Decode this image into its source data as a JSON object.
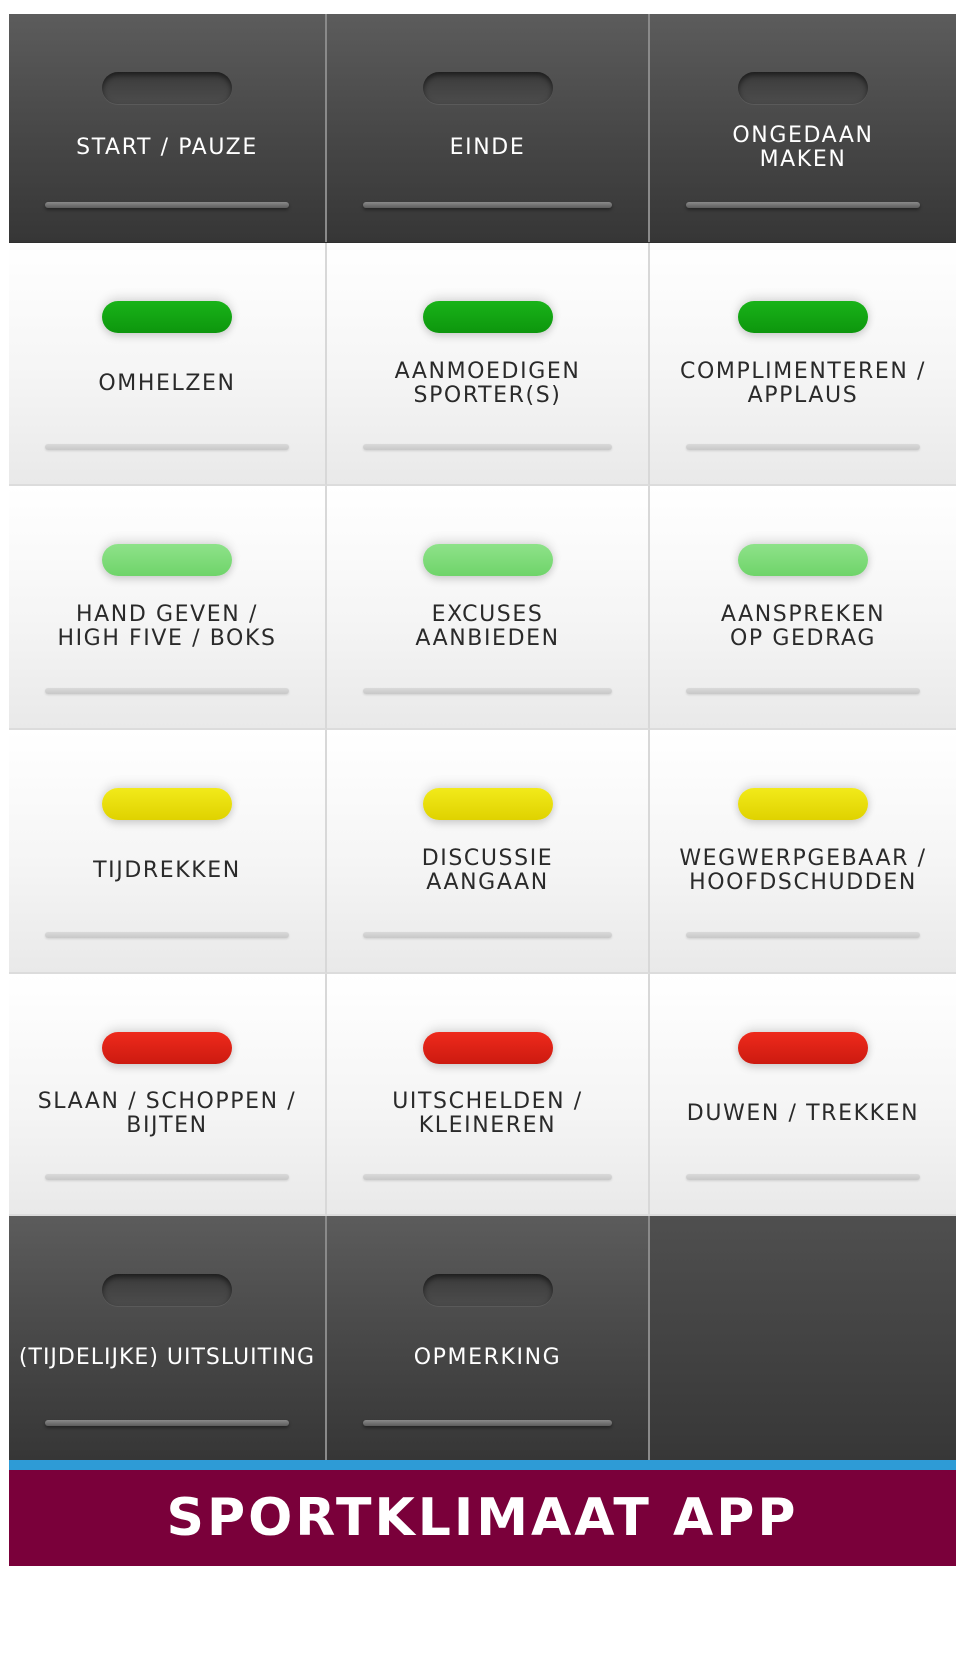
{
  "rows": [
    {
      "style": "dark",
      "cells": [
        {
          "label": "START / PAUZE",
          "indicator": "none"
        },
        {
          "label": "EINDE",
          "indicator": "none"
        },
        {
          "label": "ONGEDAAN\nMAKEN",
          "indicator": "none"
        }
      ]
    },
    {
      "style": "light",
      "cells": [
        {
          "label": "OMHELZEN",
          "indicator": "green"
        },
        {
          "label": "AANMOEDIGEN\nSPORTER(S)",
          "indicator": "green"
        },
        {
          "label": "COMPLIMENTEREN /\nAPPLAUS",
          "indicator": "green"
        }
      ]
    },
    {
      "style": "light",
      "cells": [
        {
          "label": "HAND GEVEN /\nHIGH FIVE / BOKS",
          "indicator": "lightgreen"
        },
        {
          "label": "EXCUSES\nAANBIEDEN",
          "indicator": "lightgreen"
        },
        {
          "label": "AANSPREKEN\nOP GEDRAG",
          "indicator": "lightgreen"
        }
      ]
    },
    {
      "style": "light",
      "cells": [
        {
          "label": "TIJDREKKEN",
          "indicator": "yellow"
        },
        {
          "label": "DISCUSSIE\nAANGAAN",
          "indicator": "yellow"
        },
        {
          "label": "WEGWERPGEBAAR /\nHOOFDSCHUDDEN",
          "indicator": "yellow"
        }
      ]
    },
    {
      "style": "light",
      "cells": [
        {
          "label": "SLAAN / SCHOPPEN /\nBIJTEN",
          "indicator": "red"
        },
        {
          "label": "UITSCHELDEN /\nKLEINEREN",
          "indicator": "red"
        },
        {
          "label": "DUWEN / TREKKEN",
          "indicator": "red"
        }
      ]
    },
    {
      "style": "dark",
      "cells": [
        {
          "label": "(TIJDELIJKE) UITSLUITING",
          "indicator": "none"
        },
        {
          "label": "OPMERKING",
          "indicator": "none"
        },
        {
          "label": "",
          "indicator": "empty"
        }
      ]
    }
  ],
  "footer": {
    "title": "SPORTKLIMAAT APP"
  },
  "colors": {
    "accent_line": "#2e9bd6",
    "footer_bg": "#7a003a",
    "green": "#12a512",
    "lightgreen": "#7fdb7a",
    "yellow": "#e8de00",
    "red": "#dd2216"
  }
}
